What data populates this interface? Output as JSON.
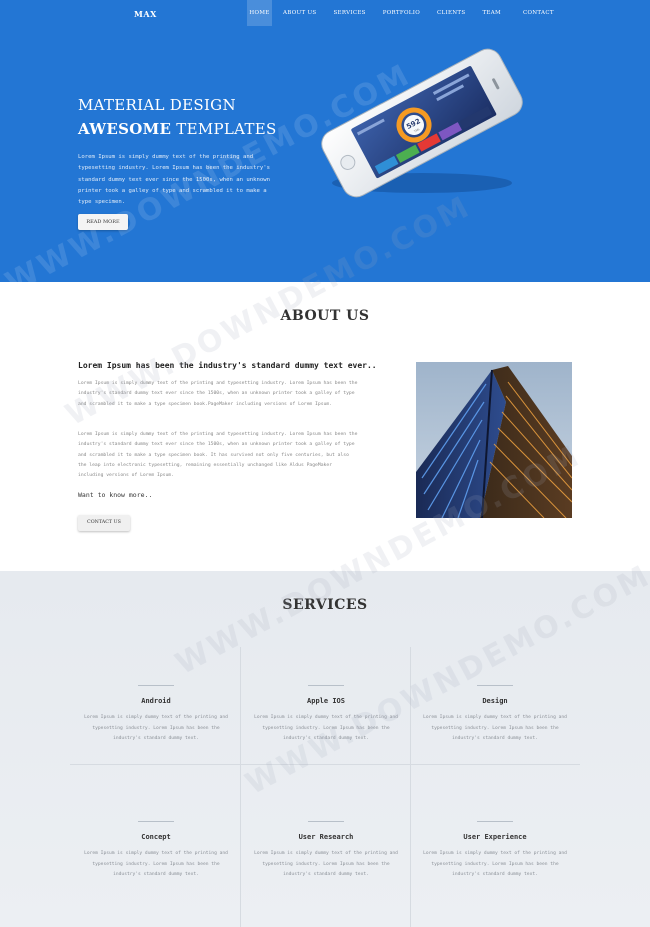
{
  "nav": {
    "logo": "MAX",
    "items": [
      {
        "label": "HOME"
      },
      {
        "label": "ABOUT US"
      },
      {
        "label": "SERVICES"
      },
      {
        "label": "PORTFOLIO"
      },
      {
        "label": "CLIENTS"
      },
      {
        "label": "TEAM"
      },
      {
        "label": "CONTACT"
      }
    ]
  },
  "hero": {
    "title_line1": "MATERIAL DESIGN",
    "title_bold": "AWESOME",
    "title_rest": " TEMPLATES",
    "text": "Lorem Ipsum is simply dummy text of the printing and typesetting industry. Lorem Ipsum has been the industry's standard dummy text ever since the 1500s, when an unknown printer took a galley of type and scrambled it to make a type specimen.",
    "button": "READ MORE",
    "phone_value": "592",
    "phone_unit": "TML",
    "accent_color": "#2376d4"
  },
  "about": {
    "title": "ABOUT US",
    "heading": "Lorem Ipsum has been the industry's standard dummy text ever..",
    "p1": "Lorem Ipsum is simply dummy text of the printing and typesetting industry. Lorem Ipsum has been the industry's standard dummy text ever since the 1500s, when an unknown printer took a galley of type and scrambled it to make a type specimen book.PageMaker including versions of Lorem Ipsum.",
    "p2": "Lorem Ipsum is simply dummy text of the printing and typesetting industry. Lorem Ipsum has been the industry's standard dummy text ever since the 1500s, when an unknown printer took a galley of type and scrambled it to make a type specimen book. It has survived not only five centuries, but also the leap into electronic typesetting, remaining essentially unchanged like Aldus PageMaker including versions of Lorem Ipsum.",
    "want": "Want to know more..",
    "button": "CONTACT US"
  },
  "services": {
    "title": "SERVICES",
    "items": [
      {
        "name": "Android",
        "desc": "Lorem Ipsum is simply dummy text of the printing and typesetting industry. Lorem Ipsum has been the industry's standard dummy text."
      },
      {
        "name": "Apple IOS",
        "desc": "Lorem Ipsum is simply dummy text of the printing and typesetting industry. Lorem Ipsum has been the industry's standard dummy text."
      },
      {
        "name": "Design",
        "desc": "Lorem Ipsum is simply dummy text of the printing and typesetting industry. Lorem Ipsum has been the industry's standard dummy text."
      },
      {
        "name": "Concept",
        "desc": "Lorem Ipsum is simply dummy text of the printing and typesetting industry. Lorem Ipsum has been the industry's standard dummy text."
      },
      {
        "name": "User Research",
        "desc": "Lorem Ipsum is simply dummy text of the printing and typesetting industry. Lorem Ipsum has been the industry's standard dummy text."
      },
      {
        "name": "User Experience",
        "desc": "Lorem Ipsum is simply dummy text of the printing and typesetting industry. Lorem Ipsum has been the industry's standard dummy text."
      }
    ]
  },
  "watermark": "WWW.DOWNDEMO.COM"
}
